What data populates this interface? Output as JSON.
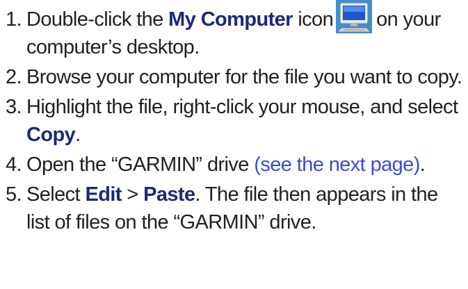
{
  "steps": [
    {
      "number": "1.",
      "t1": "Double-click the ",
      "bold1": "My Computer",
      "t2": " icon",
      "icon": "my-computer-icon",
      "t3": "on your computer’s desktop."
    },
    {
      "number": "2.",
      "t1": "Browse your computer for the file you want to copy."
    },
    {
      "number": "3.",
      "t1": "Highlight the file, right-click your mouse, and select ",
      "bold1": "Copy",
      "t2": "."
    },
    {
      "number": "4.",
      "t1": "Open the “GARMIN” drive ",
      "link": "(see the next page)",
      "t2": "."
    },
    {
      "number": "5.",
      "t1": "Select ",
      "bold1": "Edit",
      "t2": " > ",
      "bold2": "Paste",
      "t3": ". The file then appears in the list of files on the “GARMIN” drive."
    }
  ],
  "colors": {
    "text": "#231f20",
    "bold": "#1a2a7a",
    "link": "#3b4bd9"
  }
}
